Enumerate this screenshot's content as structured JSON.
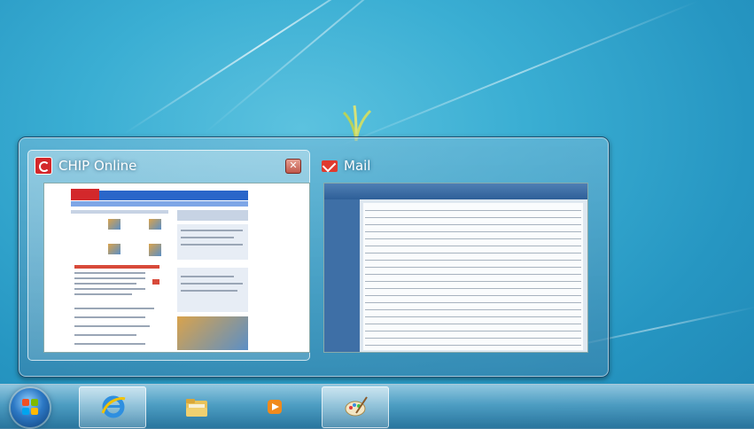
{
  "thumbnails": {
    "items": [
      {
        "title": "CHIP Online",
        "icon": "chip-online-icon",
        "active": true,
        "close_glyph": "✕"
      },
      {
        "title": "Mail",
        "icon": "mail-icon",
        "active": false
      }
    ]
  },
  "taskbar": {
    "start": {
      "icon": "windows-start-orb-icon"
    },
    "items": [
      {
        "name": "internet-explorer",
        "icon": "internet-explorer-icon",
        "active": true
      },
      {
        "name": "windows-explorer",
        "icon": "folder-icon",
        "active": false
      },
      {
        "name": "media-player",
        "icon": "media-player-icon",
        "active": false
      },
      {
        "name": "paint",
        "icon": "paint-icon",
        "active": true
      }
    ]
  },
  "colors": {
    "desktop": "#2fa3cd",
    "chip_red": "#d3282b",
    "mail_red": "#e03a2e"
  }
}
